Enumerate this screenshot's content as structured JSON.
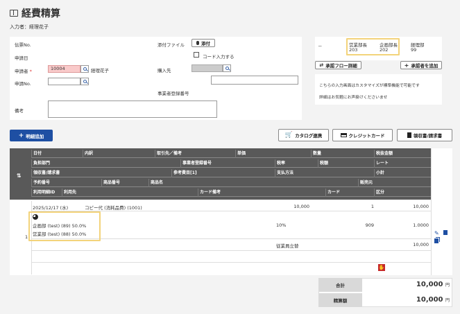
{
  "page": {
    "title": "経費精算",
    "inputter_label": "入力者：",
    "inputter_name": "経理花子"
  },
  "form": {
    "slip_no_label": "伝票No.",
    "apply_date_label": "申請日",
    "applicant_label": "申請者",
    "required_mark": "*",
    "applicant_code": "10004",
    "applicant_name": "経理花子",
    "apply_no_label": "申請No.",
    "apply_no_value": "",
    "remarks_label": "備考",
    "remarks_value": "",
    "attach_label": "添付ファイル",
    "attach_button": "添付",
    "code_input_label": "コード入力する",
    "purchaser_label": "購入先",
    "business_reg_label": "事業者登録番号"
  },
  "approval": {
    "dash": "－",
    "cols": [
      {
        "title": "営業部長",
        "code": "203"
      },
      {
        "title": "企画部長",
        "code": "202"
      },
      {
        "title": "経理部",
        "code": "99"
      }
    ],
    "flow_detail_button": "承認フロー詳細",
    "add_approver_button": "承認者を追加",
    "note_line1": "こちらの入力画面はカスタマイズが標準機能で可能です",
    "note_line2": "詳細はお気軽にお声掛けくださいませ"
  },
  "toolbar": {
    "add_detail": "明細追加",
    "catalog": "カタログ連携",
    "credit_card": "クレジットカード",
    "receipt": "領収書/請求書"
  },
  "table": {
    "header_row1": [
      "日付",
      "内訳",
      "取引先／備考",
      "単価",
      "数量",
      "税抜金額"
    ],
    "header_row2": [
      "負担部門",
      "事業者登録番号",
      "税率",
      "税額",
      "レート"
    ],
    "header_row3": [
      "領収書/請求書",
      "参考費目[1]",
      "支払方法",
      "小計"
    ],
    "header_row4": [
      "予約番号",
      "商品番号",
      "商品名",
      "販売元"
    ],
    "header_row5": [
      "利用明細ID",
      "利用先",
      "カード備考",
      "カード",
      "区分"
    ],
    "row": {
      "no": "1",
      "date": "2025/12/17 (水)",
      "item": "コピー代 (消耗品費) (1001)",
      "unit_price": "10,000",
      "qty": "1",
      "amount": "10,000",
      "dept1": "企画部 (test) (89)",
      "dept1_pct": "50.0%",
      "dept2": "営業部 (test) (88)",
      "dept2_pct": "50.0%",
      "tax_rate": "10%",
      "tax": "909",
      "rate": "1.0000",
      "payment": "従業員立替",
      "subtotal": "10,000"
    }
  },
  "totals": {
    "total_label": "合計",
    "total_value": "10,000",
    "settle_label": "精算額",
    "settle_value": "10,000",
    "currency": "円"
  }
}
